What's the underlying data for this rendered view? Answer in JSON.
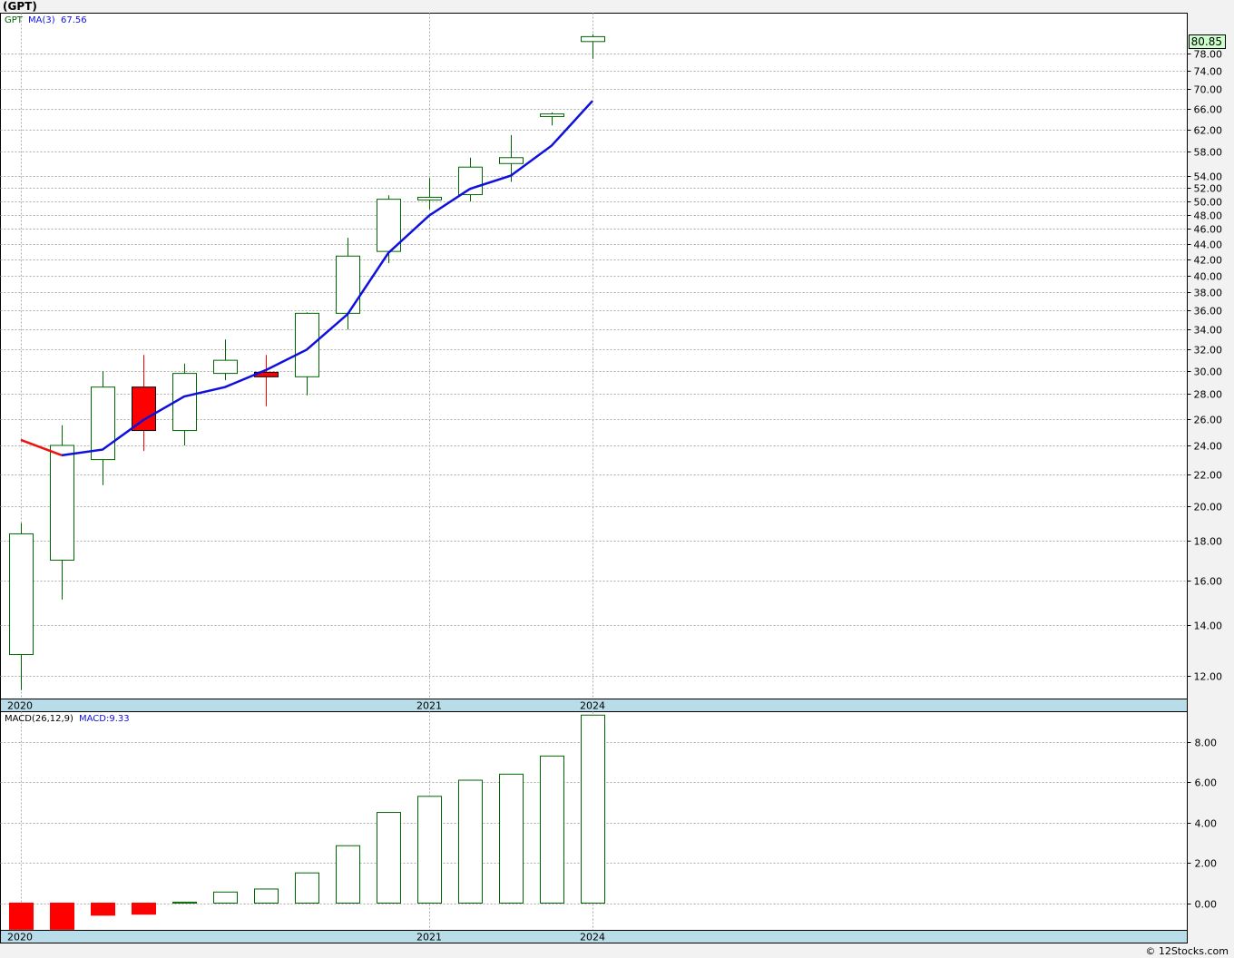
{
  "header": {
    "title": "(GPT)"
  },
  "footer": {
    "copyright": "© 12Stocks.com"
  },
  "chart_data": [
    {
      "type": "candlestick",
      "legend": {
        "symbol": "GPT",
        "ma_label": "MA(3)",
        "ma_value": "67.56"
      },
      "last_price_label": "80.85",
      "x_labels": [
        {
          "text": "2020",
          "index": 0
        },
        {
          "text": "2021",
          "index": 10
        },
        {
          "text": "2024",
          "index": 14
        }
      ],
      "y_scale": "log",
      "ylim": [
        11.2,
        88
      ],
      "y_ticks": [
        "12.00",
        "14.00",
        "16.00",
        "18.00",
        "20.00",
        "22.00",
        "24.00",
        "26.00",
        "28.00",
        "30.00",
        "32.00",
        "34.00",
        "36.00",
        "38.00",
        "40.00",
        "42.00",
        "44.00",
        "46.00",
        "48.00",
        "50.00",
        "52.00",
        "54.00",
        "58.00",
        "62.00",
        "66.00",
        "70.00",
        "74.00",
        "78.00"
      ],
      "candles": [
        {
          "open": 12.8,
          "high": 19.0,
          "low": 11.5,
          "close": 18.4
        },
        {
          "open": 17.0,
          "high": 25.5,
          "low": 15.1,
          "close": 24.0
        },
        {
          "open": 23.0,
          "high": 30.0,
          "low": 21.3,
          "close": 28.6
        },
        {
          "open": 28.6,
          "high": 31.5,
          "low": 23.6,
          "close": 25.1
        },
        {
          "open": 25.1,
          "high": 30.7,
          "low": 24.0,
          "close": 29.8
        },
        {
          "open": 29.8,
          "high": 33.0,
          "low": 29.2,
          "close": 31.0
        },
        {
          "open": 29.9,
          "high": 31.5,
          "low": 27.0,
          "close": 29.5
        },
        {
          "open": 29.5,
          "high": 35.8,
          "low": 27.9,
          "close": 35.7
        },
        {
          "open": 35.7,
          "high": 44.8,
          "low": 34.0,
          "close": 42.4
        },
        {
          "open": 43.0,
          "high": 50.9,
          "low": 41.5,
          "close": 50.3
        },
        {
          "open": 50.2,
          "high": 53.6,
          "low": 48.8,
          "close": 50.6
        },
        {
          "open": 51.0,
          "high": 57.0,
          "low": 50.0,
          "close": 55.4
        },
        {
          "open": 56.0,
          "high": 61.0,
          "low": 53.0,
          "close": 57.0
        },
        {
          "open": 64.5,
          "high": 65.3,
          "low": 62.8,
          "close": 65.0
        },
        {
          "open": 80.8,
          "high": 82.6,
          "low": 76.7,
          "close": 82.0
        }
      ],
      "ma": [
        24.4,
        23.3,
        23.7,
        25.9,
        27.8,
        28.6,
        30.1,
        32.0,
        35.6,
        42.8,
        47.9,
        51.9,
        54.0,
        59.1,
        67.6
      ],
      "ma_colors": {
        "down": "#ee1111",
        "up": "#1010dd"
      },
      "colors": {
        "up": "#006600",
        "down": "#ff0000",
        "grid": "#b0b0b0",
        "axis_band": "#b8dce8",
        "price_box": "#ccffcc"
      }
    },
    {
      "type": "bar",
      "legend": {
        "label": "MACD(26,12,9)",
        "value_label": "MACD:9.33"
      },
      "x_labels": [
        {
          "text": "2020",
          "index": 0
        },
        {
          "text": "2021",
          "index": 10
        },
        {
          "text": "2024",
          "index": 14
        }
      ],
      "ylim": [
        -1.35,
        9.5
      ],
      "y_ticks": [
        "0.00",
        "2.00",
        "4.00",
        "6.00",
        "8.00"
      ],
      "values": [
        -1.3,
        -1.3,
        -0.6,
        -0.55,
        0.05,
        0.55,
        0.7,
        1.5,
        2.85,
        4.5,
        5.3,
        6.1,
        6.4,
        7.3,
        9.33
      ]
    }
  ]
}
